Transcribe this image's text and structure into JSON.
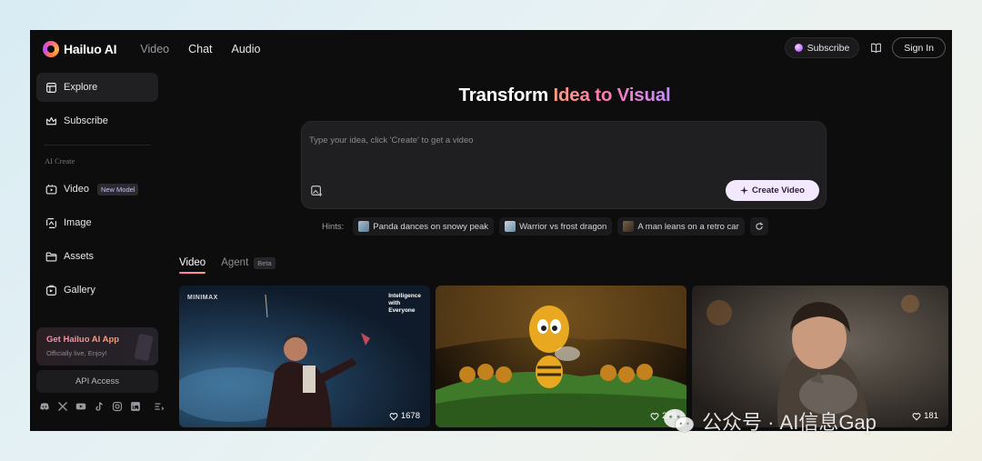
{
  "header": {
    "brand": "Hailuo AI",
    "nav": [
      {
        "label": "Video",
        "active": true
      },
      {
        "label": "Chat"
      },
      {
        "label": "Audio"
      }
    ],
    "subscribe_label": "Subscribe",
    "signin_label": "Sign In"
  },
  "sidebar": {
    "items": [
      {
        "label": "Explore",
        "icon": "explore-icon",
        "active": true
      },
      {
        "label": "Subscribe",
        "icon": "crown-icon"
      }
    ],
    "section_label": "AI Create",
    "create_items": [
      {
        "label": "Video",
        "icon": "video-icon",
        "badge": "New Model"
      },
      {
        "label": "Image",
        "icon": "image-icon"
      },
      {
        "label": "Assets",
        "icon": "folder-icon"
      },
      {
        "label": "Gallery",
        "icon": "gallery-icon"
      }
    ],
    "app_card": {
      "title": "Get Hailuo AI App",
      "subtitle": "Officially live, Enjoy!"
    },
    "api_label": "API Access",
    "socials": [
      "discord-icon",
      "x-icon",
      "youtube-icon",
      "tiktok-icon",
      "instagram-icon",
      "linkedin-icon",
      "more-icon"
    ]
  },
  "main": {
    "headline_plain": "Transform ",
    "headline_highlight": "Idea to Visual",
    "prompt": {
      "placeholder": "Type your idea, click 'Create' to get a video",
      "value": ""
    },
    "create_label": "Create Video",
    "hints_label": "Hints:",
    "hints": [
      {
        "label": "Panda dances on snowy peak",
        "thumb_color": "#7c9ab0"
      },
      {
        "label": "Warrior vs frost dragon",
        "thumb_color": "#8ea4b8"
      },
      {
        "label": "A man leans on a retro car",
        "thumb_color": "#5a4a3a"
      }
    ],
    "tabs": [
      {
        "label": "Video",
        "active": true
      },
      {
        "label": "Agent",
        "badge": "Beta"
      }
    ],
    "cards": [
      {
        "likes": "1678",
        "brand_mark": "MINIMAX",
        "overlay_text": [
          "Intelligence",
          "with",
          "Everyone"
        ]
      },
      {
        "likes": "285"
      },
      {
        "likes": "181"
      }
    ]
  },
  "watermark": {
    "text": "公众号 · AI信息Gap"
  },
  "colors": {
    "background": "#0d0d0e",
    "surface": "#1f1f22",
    "accent_gradient": [
      "#ff9c7a",
      "#ff7bb2",
      "#c58dff"
    ],
    "create_button": "#f3e9ff"
  }
}
